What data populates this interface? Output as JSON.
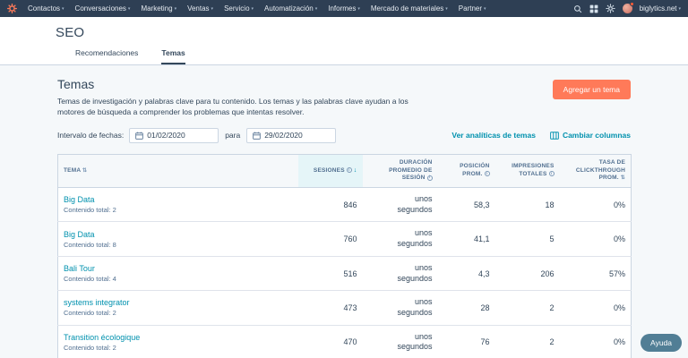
{
  "colors": {
    "navbar_bg": "#2e3f54",
    "accent_orange": "#ff7a59",
    "link_teal": "#0091ae",
    "sorted_header_bg": "#e5f5f8",
    "page_bg": "#f5f8fa"
  },
  "navbar": {
    "items": [
      {
        "label": "Contactos"
      },
      {
        "label": "Conversaciones"
      },
      {
        "label": "Marketing"
      },
      {
        "label": "Ventas"
      },
      {
        "label": "Servicio"
      },
      {
        "label": "Automatización"
      },
      {
        "label": "Informes"
      },
      {
        "label": "Mercado de materiales"
      },
      {
        "label": "Partner"
      }
    ],
    "account": "biglytics.net"
  },
  "page": {
    "title": "SEO",
    "tabs": [
      {
        "label": "Recomendaciones",
        "active": false
      },
      {
        "label": "Temas",
        "active": true
      }
    ]
  },
  "content": {
    "title": "Temas",
    "description": "Temas de investigación y palabras clave para tu contenido. Los temas y las palabras clave ayudan a los motores de búsqueda a comprender los problemas que intentas resolver.",
    "add_button": "Agregar un tema",
    "date_label": "Intervalo de fechas:",
    "date_start": "01/02/2020",
    "date_separator": "para",
    "date_end": "29/02/2020",
    "analytics_link": "Ver analíticas de temas",
    "columns_link": "Cambiar columnas"
  },
  "table": {
    "headers": [
      {
        "label": "TEMA"
      },
      {
        "label": "SESIONES"
      },
      {
        "label": "DURACIÓN PROMEDIO DE SESIÓN"
      },
      {
        "label": "POSICIÓN PROM."
      },
      {
        "label": "IMPRESIONES TOTALES"
      },
      {
        "label": "TASA DE CLICKTHROUGH PROM."
      }
    ],
    "rows": [
      {
        "topic": "Big Data",
        "meta": "Contenido total: 2",
        "sessions": "846",
        "duration": "unos segundos",
        "position": "58,3",
        "impressions": "18",
        "ctr": "0%"
      },
      {
        "topic": "Big Data",
        "meta": "Contenido total: 8",
        "sessions": "760",
        "duration": "unos segundos",
        "position": "41,1",
        "impressions": "5",
        "ctr": "0%"
      },
      {
        "topic": "Bali Tour",
        "meta": "Contenido total: 4",
        "sessions": "516",
        "duration": "unos segundos",
        "position": "4,3",
        "impressions": "206",
        "ctr": "57%"
      },
      {
        "topic": "systems integrator",
        "meta": "Contenido total: 2",
        "sessions": "473",
        "duration": "unos segundos",
        "position": "28",
        "impressions": "2",
        "ctr": "0%"
      },
      {
        "topic": "Transition écologique",
        "meta": "Contenido total: 2",
        "sessions": "470",
        "duration": "unos segundos",
        "position": "76",
        "impressions": "2",
        "ctr": "0%"
      }
    ]
  },
  "help": {
    "label": "Ayuda"
  }
}
